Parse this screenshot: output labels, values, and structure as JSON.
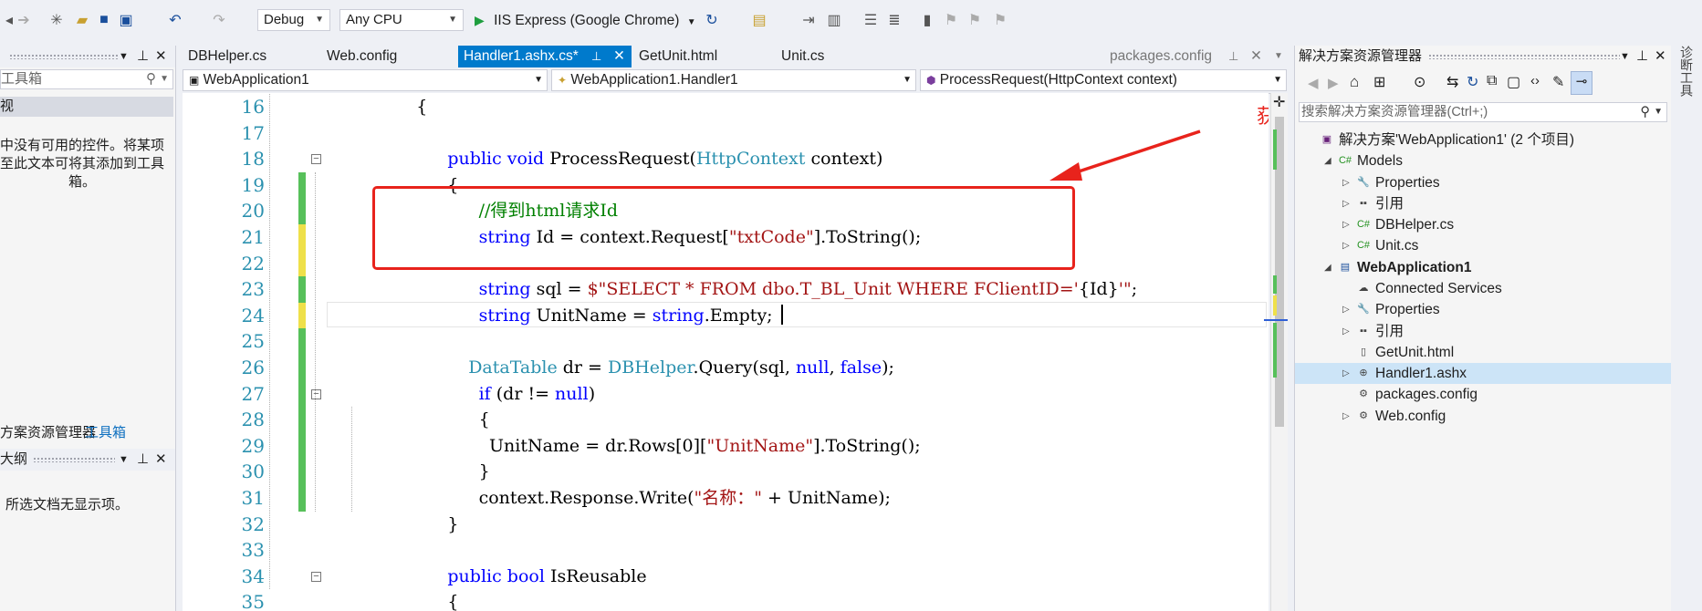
{
  "toolbar": {
    "config": "Debug",
    "platform": "Any CPU",
    "run_target": "IIS Express (Google Chrome)"
  },
  "tabs": [
    {
      "label": "DBHelper.cs"
    },
    {
      "label": "Web.config"
    },
    {
      "label": "Handler1.ashx.cs*"
    },
    {
      "label": "GetUnit.html"
    },
    {
      "label": "Unit.cs"
    },
    {
      "label": "packages.config"
    }
  ],
  "nav": {
    "project": "WebApplication1",
    "class": "WebApplication1.Handler1",
    "member": "ProcessRequest(HttpContext context)"
  },
  "left_panel": {
    "search_placeholder": "工具箱",
    "group_label": "视",
    "empty_message": "中没有可用的控件。将某项\n至此文本可将其添加到工具\n箱。",
    "tab_solution": "方案资源管理器",
    "tab_toolbox": "工具箱",
    "outline_title": "大纲",
    "outline_message": "所选文档无显示项。"
  },
  "annotation": "获取得到请求数据",
  "code_lines": [
    {
      "n": "16",
      "indent": 8,
      "segs": [
        [
          "p",
          "{"
        ]
      ]
    },
    {
      "n": "17",
      "indent": 0,
      "segs": []
    },
    {
      "n": "18",
      "indent": 11,
      "segs": [
        [
          "k",
          "public"
        ],
        [
          "p",
          " "
        ],
        [
          "k",
          "void"
        ],
        [
          "p",
          " ProcessRequest("
        ],
        [
          "t",
          "HttpContext"
        ],
        [
          "p",
          " context)"
        ]
      ]
    },
    {
      "n": "19",
      "indent": 11,
      "segs": [
        [
          "p",
          "{"
        ]
      ]
    },
    {
      "n": "20",
      "indent": 14,
      "segs": [
        [
          "c",
          "//得到html请求Id"
        ]
      ]
    },
    {
      "n": "21",
      "indent": 14,
      "segs": [
        [
          "k",
          "string"
        ],
        [
          "p",
          " Id = context.Request["
        ],
        [
          "s",
          "\"txtCode\""
        ],
        [
          "p",
          "].ToString();"
        ]
      ]
    },
    {
      "n": "22",
      "indent": 0,
      "segs": []
    },
    {
      "n": "23",
      "indent": 14,
      "segs": [
        [
          "k",
          "string"
        ],
        [
          "p",
          " sql = "
        ],
        [
          "s",
          "$\"SELECT * FROM dbo.T_BL_Unit WHERE FClientID='"
        ],
        [
          "p",
          "{Id}"
        ],
        [
          "s",
          "'\""
        ],
        [
          "p",
          ";"
        ]
      ]
    },
    {
      "n": "24",
      "indent": 14,
      "segs": [
        [
          "k",
          "string"
        ],
        [
          "p",
          " UnitName = "
        ],
        [
          "k",
          "string"
        ],
        [
          "p",
          ".Empty;"
        ]
      ]
    },
    {
      "n": "25",
      "indent": 0,
      "segs": []
    },
    {
      "n": "26",
      "indent": 13,
      "segs": [
        [
          "t",
          "DataTable"
        ],
        [
          "p",
          " dr = "
        ],
        [
          "t",
          "DBHelper"
        ],
        [
          "p",
          ".Query(sql, "
        ],
        [
          "k",
          "null"
        ],
        [
          "p",
          ", "
        ],
        [
          "k",
          "false"
        ],
        [
          "p",
          ");"
        ]
      ]
    },
    {
      "n": "27",
      "indent": 14,
      "segs": [
        [
          "k",
          "if"
        ],
        [
          "p",
          " (dr != "
        ],
        [
          "k",
          "null"
        ],
        [
          "p",
          ")"
        ]
      ]
    },
    {
      "n": "28",
      "indent": 14,
      "segs": [
        [
          "p",
          "{"
        ]
      ]
    },
    {
      "n": "29",
      "indent": 15,
      "segs": [
        [
          "p",
          "UnitName = dr.Rows[0]["
        ],
        [
          "s",
          "\"UnitName\""
        ],
        [
          "p",
          "].ToString();"
        ]
      ]
    },
    {
      "n": "30",
      "indent": 14,
      "segs": [
        [
          "p",
          "}"
        ]
      ]
    },
    {
      "n": "31",
      "indent": 14,
      "segs": [
        [
          "p",
          "context.Response.Write("
        ],
        [
          "s",
          "\"名称：\""
        ],
        [
          "p",
          " + UnitName);"
        ]
      ]
    },
    {
      "n": "32",
      "indent": 11,
      "segs": [
        [
          "p",
          "}"
        ]
      ]
    },
    {
      "n": "33",
      "indent": 0,
      "segs": []
    },
    {
      "n": "34",
      "indent": 11,
      "segs": [
        [
          "k",
          "public"
        ],
        [
          "p",
          " "
        ],
        [
          "k",
          "bool"
        ],
        [
          "p",
          " IsReusable"
        ]
      ]
    },
    {
      "n": "35",
      "indent": 11,
      "segs": [
        [
          "p",
          "{"
        ]
      ]
    }
  ],
  "solution": {
    "title": "解决方案资源管理器",
    "search_placeholder": "搜索解决方案资源管理器(Ctrl+;)",
    "items": [
      {
        "label": "解决方案'WebApplication1' (2 个项目)",
        "icon": "solution-icon"
      },
      {
        "label": "Models",
        "icon": "csharp-project-icon"
      },
      {
        "label": "Properties",
        "icon": "wrench-icon"
      },
      {
        "label": "引用",
        "icon": "references-icon"
      },
      {
        "label": "DBHelper.cs",
        "icon": "csharp-file-icon"
      },
      {
        "label": "Unit.cs",
        "icon": "csharp-file-icon"
      },
      {
        "label": "WebApplication1",
        "icon": "web-project-icon"
      },
      {
        "label": "Connected Services",
        "icon": "connected-services-icon"
      },
      {
        "label": "Properties",
        "icon": "wrench-icon"
      },
      {
        "label": "引用",
        "icon": "references-icon"
      },
      {
        "label": "GetUnit.html",
        "icon": "html-file-icon"
      },
      {
        "label": "Handler1.ashx",
        "icon": "handler-file-icon"
      },
      {
        "label": "packages.config",
        "icon": "config-file-icon"
      },
      {
        "label": "Web.config",
        "icon": "config-file-icon"
      }
    ]
  },
  "right_edge_label": "诊断工具",
  "colors": {
    "accent": "#007acc",
    "annotation": "#e8231c",
    "keyword": "#0000ff",
    "type": "#2b91af",
    "string": "#a31515",
    "comment": "#008000"
  }
}
